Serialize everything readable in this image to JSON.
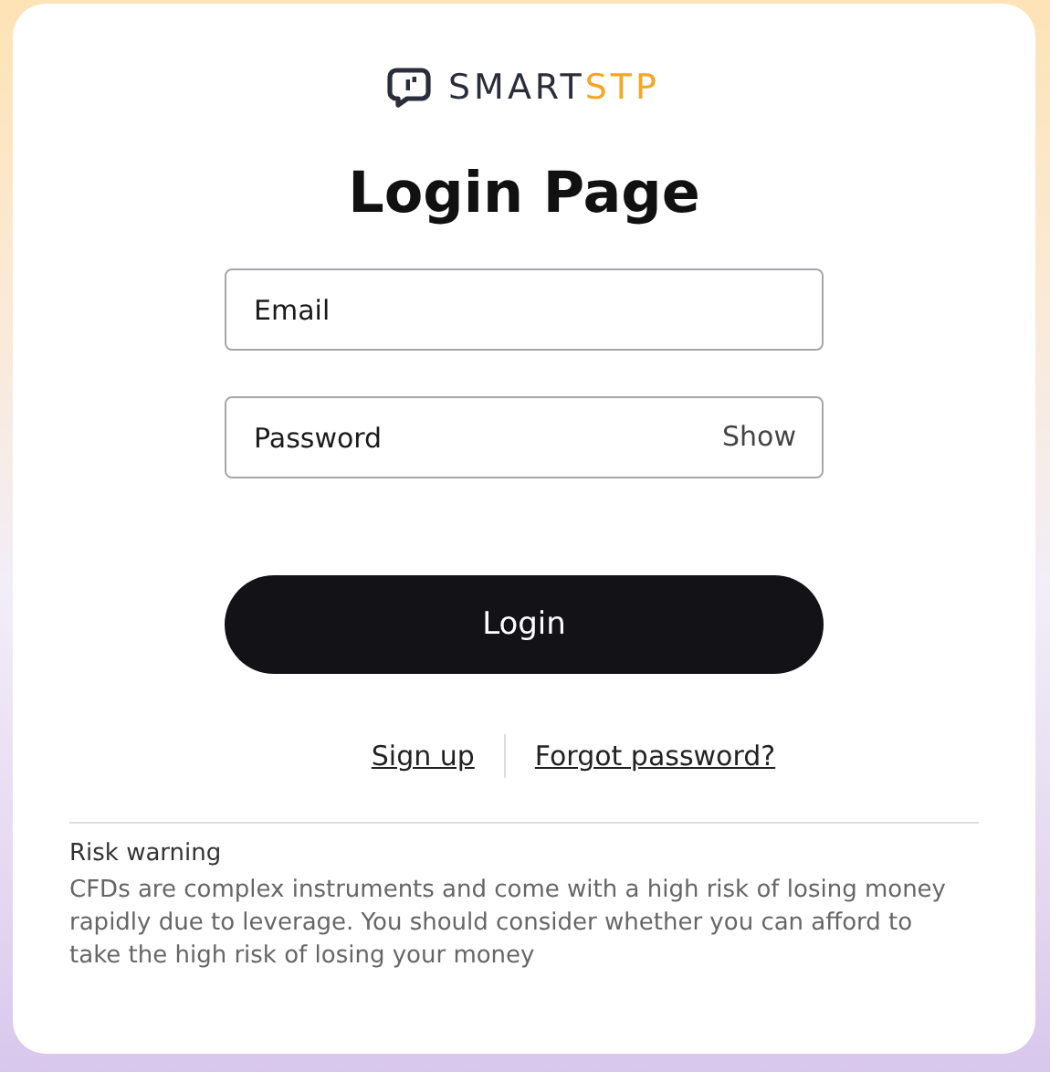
{
  "logo": {
    "primary": "SMART",
    "accent": "STP"
  },
  "title": "Login Page",
  "fields": [
    {
      "placeholder": "Email",
      "kind": "text"
    },
    {
      "placeholder": "Password",
      "kind": "password",
      "toggle": "Show"
    }
  ],
  "login_button": "Login",
  "links": [
    "Sign up",
    "Forgot password?"
  ],
  "risk_warning": {
    "title": "Risk warning",
    "text": "CFDs are complex instruments and come with a high risk of losing money rapidly due to leverage. You should consider whether you can afford to take the high risk of losing your money"
  }
}
